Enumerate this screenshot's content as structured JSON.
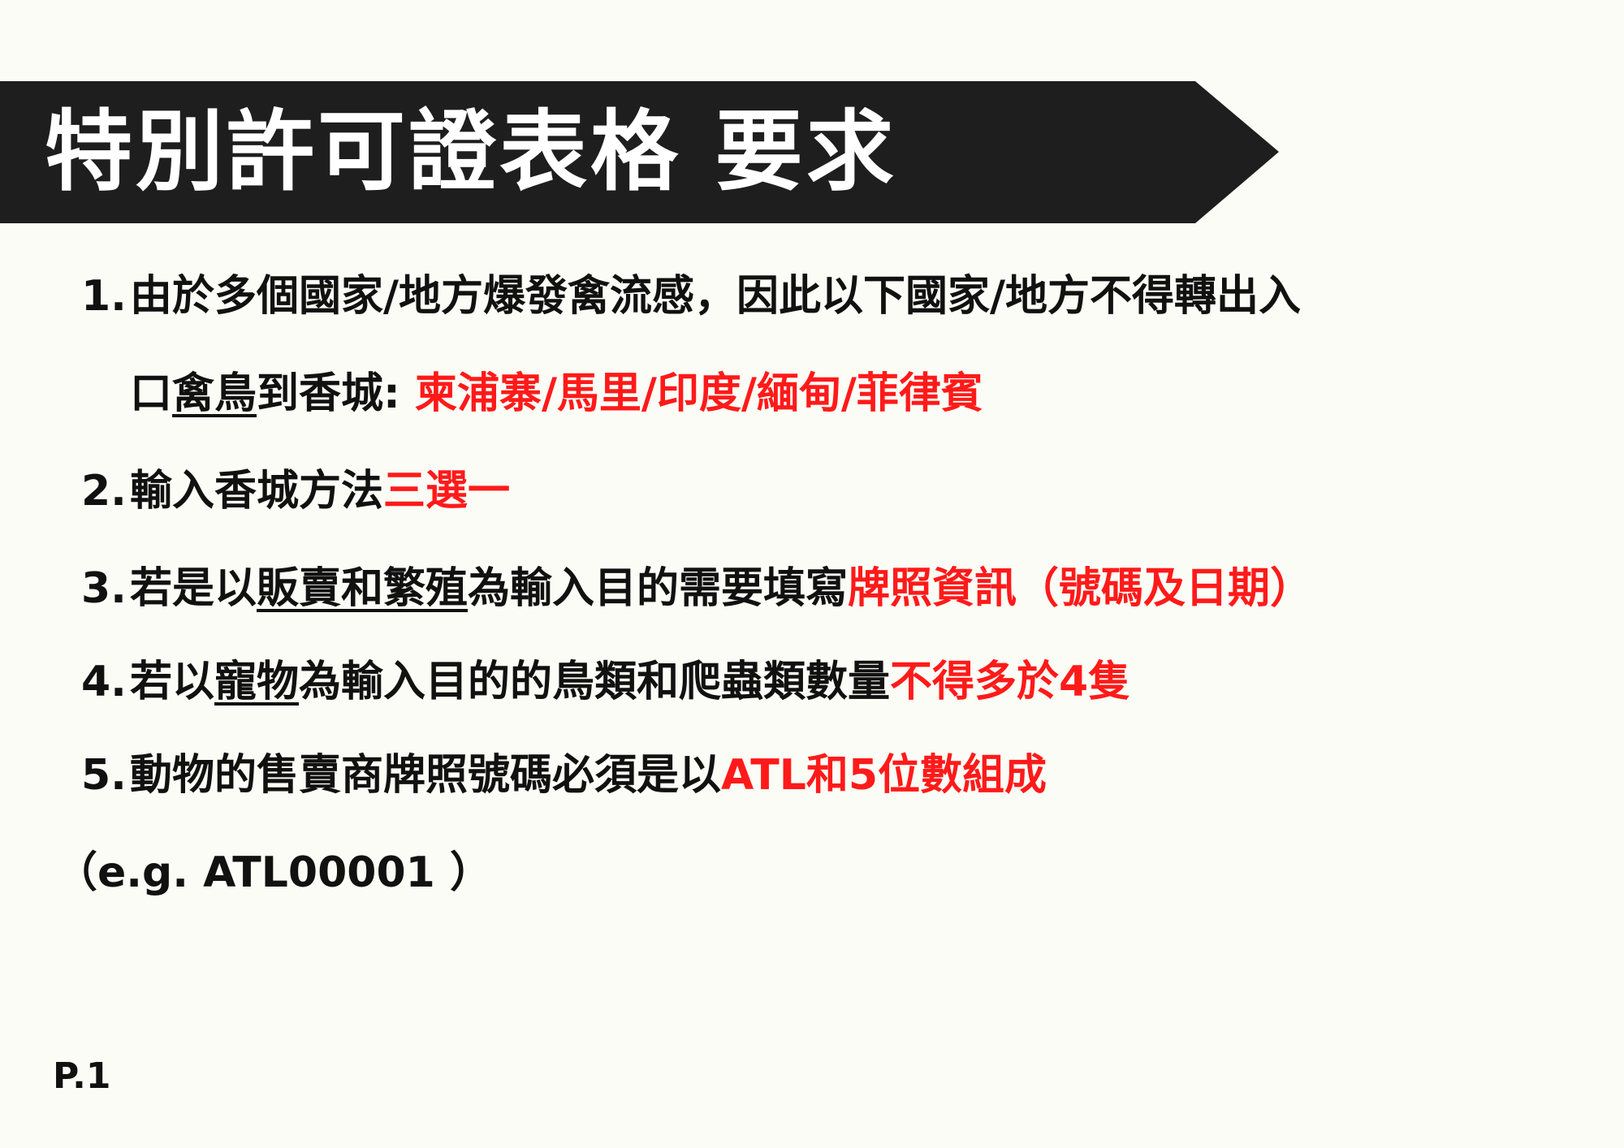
{
  "header": {
    "title": "特別許可證表格 要求"
  },
  "items": [
    {
      "num": "1.",
      "text_a": "由於多個國家/地方爆發禽流感，因此以下國家/地方不得轉出入",
      "text_b1": "口",
      "text_b_u": "禽鳥",
      "text_b2": "到香城: ",
      "text_b_red": "柬浦寨/馬里/印度/緬甸/菲律賓"
    },
    {
      "num": "2.",
      "text": "輸入香城方法",
      "red": "三選一"
    },
    {
      "num": "3.",
      "text_a": "若是以",
      "u": "販賣和繁殖",
      "text_b": "為輸入目的需要填寫",
      "red": "牌照資訊（號碼及日期）"
    },
    {
      "num": "4.",
      "text_a": "若以",
      "u": "寵物",
      "text_b": "為輸入目的的鳥類和爬蟲類數量",
      "red": "不得多於4隻"
    },
    {
      "num": "5.",
      "text": "動物的售賣商牌照號碼必須是以",
      "red": "ATL和5位數組成"
    }
  ],
  "example": "（e.g.  ATL00001 ）",
  "page_label": "P.1",
  "colors": {
    "accent_red": "#ff1a1a",
    "banner": "#1e1e1e",
    "background": "#fbfcf5"
  }
}
